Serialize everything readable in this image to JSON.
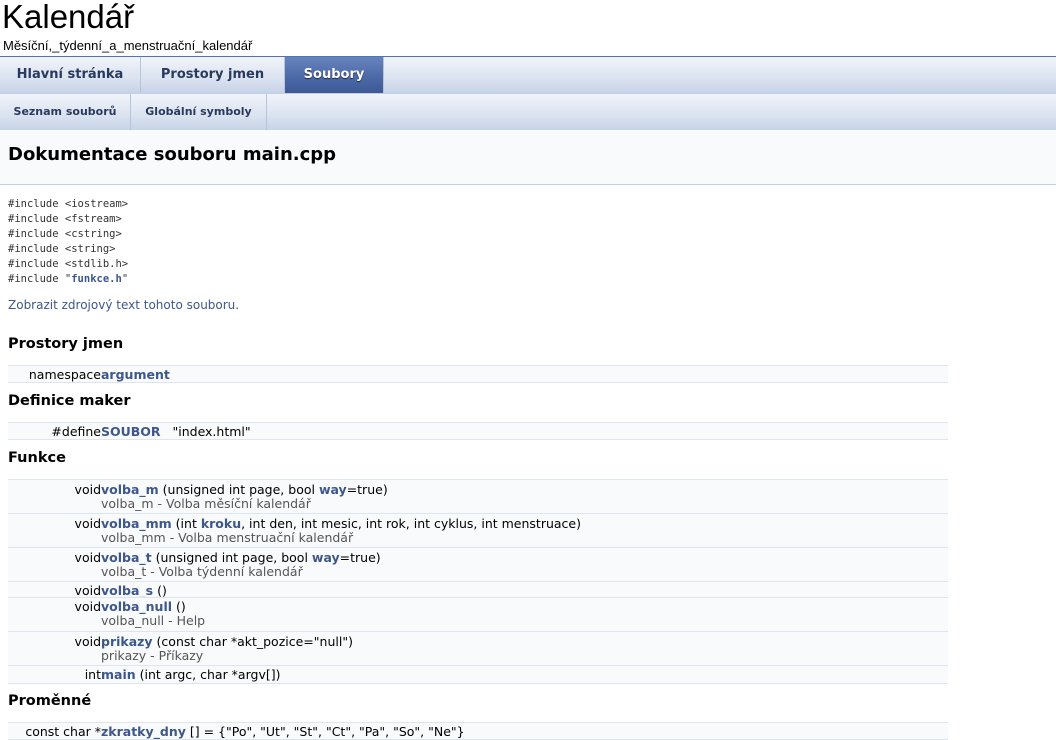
{
  "project": {
    "name": "Kalendář",
    "brief": "Měsíční,_týdenní_a_menstruační_kalendář"
  },
  "tabs": [
    {
      "label": "Hlavní stránka",
      "current": false
    },
    {
      "label": "Prostory jmen",
      "current": false
    },
    {
      "label": "Soubory",
      "current": true
    }
  ],
  "subtabs": [
    {
      "label": "Seznam souborů"
    },
    {
      "label": "Globální symboly"
    }
  ],
  "header": {
    "title": "Dokumentace souboru main.cpp"
  },
  "includes": [
    {
      "prefix": "#include ",
      "name": "<iostream>",
      "link": false
    },
    {
      "prefix": "#include ",
      "name": "<fstream>",
      "link": false
    },
    {
      "prefix": "#include ",
      "name": "<cstring>",
      "link": false
    },
    {
      "prefix": "#include ",
      "name": "<string>",
      "link": false
    },
    {
      "prefix": "#include ",
      "name": "<stdlib.h>",
      "link": false
    },
    {
      "prefix": "#include ",
      "pre": "\"",
      "name": "funkce.h",
      "post": "\"",
      "link": true
    }
  ],
  "source_link": "Zobrazit zdrojový text tohoto souboru.",
  "sections": {
    "namespaces": {
      "title": "Prostory jmen",
      "rows": [
        {
          "left": "namespace",
          "name": "argument"
        }
      ]
    },
    "macros": {
      "title": "Definice maker",
      "rows": [
        {
          "left": "#define",
          "name": "SOUBOR",
          "rest": "\"index.html\""
        }
      ]
    },
    "functions": {
      "title": "Funkce",
      "rows": [
        {
          "left": "void",
          "name": "volba_m",
          "sig_a": " (unsigned int page, bool ",
          "sig_link": "way",
          "sig_b": "=true)",
          "desc": "volba_m - Volba měsíční kalendář"
        },
        {
          "left": "void",
          "name": "volba_mm",
          "sig_a": " (int ",
          "sig_link": "kroku",
          "sig_b": ", int den, int mesic, int rok, int cyklus, int menstruace)",
          "desc": "volba_mm - Volba menstruační kalendář"
        },
        {
          "left": "void",
          "name": "volba_t",
          "sig_a": " (unsigned int page, bool ",
          "sig_link": "way",
          "sig_b": "=true)",
          "desc": "volba_t - Volba týdenní kalendář"
        },
        {
          "left": "void",
          "name": "volba_s",
          "sig_a": " ()",
          "sig_link": "",
          "sig_b": "",
          "desc": ""
        },
        {
          "left": "void",
          "name": "volba_null",
          "sig_a": " ()",
          "sig_link": "",
          "sig_b": "",
          "desc": "volba_null - Help"
        },
        {
          "left": "void",
          "name": "prikazy",
          "sig_a": " (const char *akt_pozice=\"null\")",
          "sig_link": "",
          "sig_b": "",
          "desc": "prikazy - Příkazy"
        },
        {
          "left": "int",
          "name": "main",
          "sig_a": " (int argc, char *argv[])",
          "sig_link": "",
          "sig_b": "",
          "desc": ""
        }
      ]
    },
    "variables": {
      "title": "Proměnné",
      "rows": [
        {
          "left": "const char *",
          "name": "zkratky_dny",
          "rest": " [] = {\"Po\", \"Ut\", \"St\", \"Ct\", \"Pa\", \"So\", \"Ne\"}"
        }
      ]
    }
  }
}
